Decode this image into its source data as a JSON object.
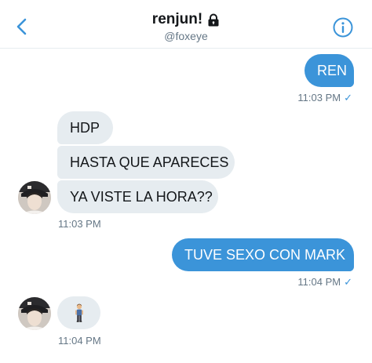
{
  "header": {
    "name": "renjun!",
    "handle": "@foxeye",
    "icons": {
      "back": "chevron-left-icon",
      "lock": "lock-icon",
      "info": "info-icon"
    }
  },
  "messages": [
    {
      "direction": "out",
      "text": "REN"
    },
    {
      "direction": "in",
      "text": "HDP"
    },
    {
      "direction": "in",
      "text": "HASTA QUE APARECES"
    },
    {
      "direction": "in",
      "text": "YA VISTE LA HORA??"
    },
    {
      "direction": "out",
      "text": "TUVE SEXO CON MARK"
    },
    {
      "direction": "in",
      "text": "",
      "emoji": "standing-person-emoji"
    }
  ],
  "timestamps": {
    "t1": "11:03 PM",
    "t2": "11:03 PM",
    "t3": "11:04 PM",
    "t4": "11:04 PM"
  },
  "read_mark": "✓",
  "colors": {
    "accent": "#3b94d9",
    "incoming": "#e6ecf0",
    "meta": "#657786"
  }
}
